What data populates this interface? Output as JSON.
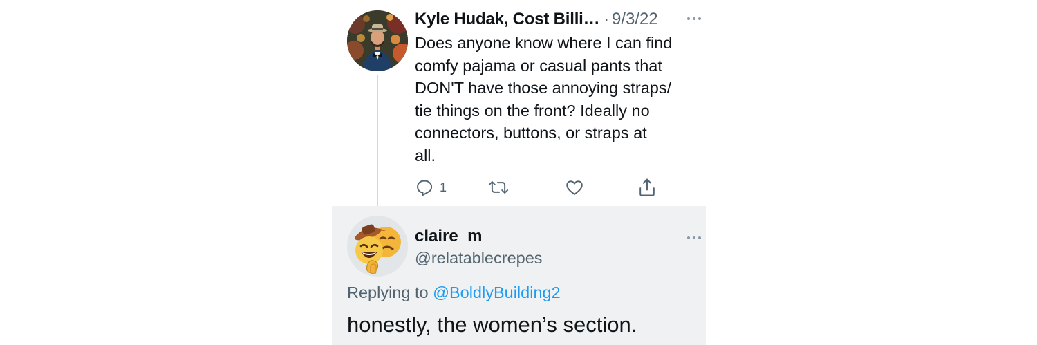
{
  "parent_tweet": {
    "author_name": "Kyle Hudak, Cost Billi",
    "name_truncation": "…",
    "separator": "·",
    "date": "9/3/22",
    "text": "Does anyone know where I can find\ncomfy pajama or casual pants that\nDON'T have those annoying straps/\ntie things on the front? Ideally no\nconnectors, buttons, or straps at\nall.",
    "reply_count": "1",
    "icons": {
      "more": "more-icon",
      "reply": "reply-icon",
      "retweet": "retweet-icon",
      "like": "like-icon",
      "share": "share-icon"
    }
  },
  "reply_tweet": {
    "display_name": "claire_m",
    "handle": "@relatablecrepes",
    "replying_prefix": "Replying to",
    "replying_to": "@BoldlyBuilding2",
    "text": "honestly, the women’s section."
  },
  "colors": {
    "text_primary": "#0f1419",
    "text_secondary": "#536471",
    "link": "#1d9bf0",
    "reply_background": "#eff1f2",
    "thread_line": "#cfd9de"
  }
}
